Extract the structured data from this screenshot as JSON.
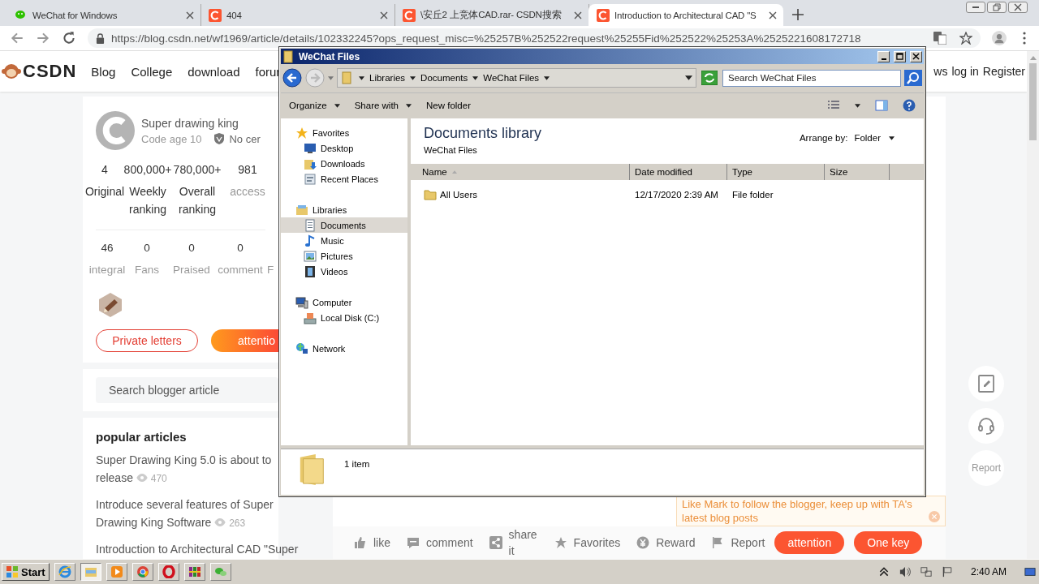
{
  "browser": {
    "tabs": [
      {
        "title": "WeChat for Windows",
        "kind": "wechat",
        "selected": false
      },
      {
        "title": "404",
        "kind": "csdn",
        "selected": false
      },
      {
        "title": "\\安丘2 上竞体CAD.rar- CSDN搜索",
        "kind": "csdn",
        "selected": false
      },
      {
        "title": "Introduction to Architectural CAD \"S",
        "kind": "csdn",
        "selected": true
      }
    ],
    "url": "https://blog.csdn.net/wf1969/article/details/102332245?ops_request_misc=%25257B%252522request%25255Fid%252522%25253A%2525221608172718"
  },
  "site_nav": {
    "logo": "CSDN",
    "items": [
      "Blog",
      "College",
      "download",
      "forur"
    ],
    "right_items": [
      "ws",
      "log in",
      "Register"
    ]
  },
  "profile": {
    "name": "Super drawing king",
    "code_age": "Code age 10",
    "certification": "No cer",
    "stats": [
      {
        "value": "4",
        "label": "Original",
        "muted": false
      },
      {
        "value": "800,000+",
        "label": "Weekly ranking",
        "muted": false
      },
      {
        "value": "780,000+",
        "label": "Overall ranking",
        "muted": false
      },
      {
        "value": "981",
        "label": "access",
        "muted": true
      }
    ],
    "stats2": [
      {
        "value": "46",
        "label": "integral"
      },
      {
        "value": "0",
        "label": "Fans"
      },
      {
        "value": "0",
        "label": "Praised"
      },
      {
        "value": "0",
        "label": "comment"
      },
      {
        "label": "F"
      }
    ],
    "private_button": "Private letters",
    "follow_button": "attentio"
  },
  "blogger_search": {
    "placeholder": "Search blogger article"
  },
  "popular_articles": {
    "title": "popular articles",
    "items": [
      {
        "title": "Super Drawing King 5.0 is about to release",
        "views": "470"
      },
      {
        "title": "Introduce several features of Super Drawing King Software",
        "views": "263"
      },
      {
        "title": "Introduction to Architectural CAD \"Super"
      }
    ]
  },
  "follow_tip": {
    "text": "Like Mark to follow the blogger, keep up with TA's latest blog posts"
  },
  "article_toolbar": {
    "actions": [
      {
        "kind": "like",
        "label": "like"
      },
      {
        "kind": "comment",
        "label": "comment"
      },
      {
        "kind": "share",
        "label": "share it"
      },
      {
        "kind": "favorites",
        "label": "Favorites"
      },
      {
        "kind": "reward",
        "label": "Reward"
      },
      {
        "kind": "report",
        "label": "Report"
      }
    ],
    "attention": "attention",
    "one_key": "One key"
  },
  "float_tools": {
    "report": "Report"
  },
  "explorer": {
    "title": "WeChat Files",
    "breadcrumb": [
      "Libraries",
      "Documents",
      "WeChat Files"
    ],
    "search": {
      "placeholder": "Search WeChat Files"
    },
    "toolbar": [
      {
        "label": "Organize",
        "dropdown": true
      },
      {
        "label": "Share with",
        "dropdown": true
      },
      {
        "label": "New folder",
        "dropdown": false
      }
    ],
    "nav": [
      {
        "label": "Favorites",
        "kind": "star",
        "selected": false,
        "children": [
          {
            "label": "Desktop",
            "kind": "desktop",
            "selected": false
          },
          {
            "label": "Downloads",
            "kind": "downloads",
            "selected": false
          },
          {
            "label": "Recent Places",
            "kind": "recent",
            "selected": false
          }
        ]
      },
      {
        "label": "Libraries",
        "kind": "library",
        "selected": false,
        "children": [
          {
            "label": "Documents",
            "kind": "document",
            "selected": true
          },
          {
            "label": "Music",
            "kind": "music",
            "selected": false
          },
          {
            "label": "Pictures",
            "kind": "pictures",
            "selected": false
          },
          {
            "label": "Videos",
            "kind": "videos",
            "selected": false
          }
        ]
      },
      {
        "label": "Computer",
        "kind": "computer",
        "selected": false,
        "children": [
          {
            "label": "Local Disk (C:)",
            "kind": "disk",
            "selected": false
          }
        ]
      },
      {
        "label": "Network",
        "kind": "network",
        "selected": false
      }
    ],
    "library_title": "Documents library",
    "library_subtitle": "WeChat Files",
    "arrange_label": "Arrange by:",
    "arrange_value": "Folder",
    "columns": [
      "Name",
      "Date modified",
      "Type",
      "Size"
    ],
    "rows": [
      {
        "name": "All Users",
        "date": "12/17/2020 2:39 AM",
        "type": "File folder"
      }
    ],
    "status": "1 item"
  },
  "taskbar": {
    "start": "Start",
    "apps": [
      {
        "kind": "ie",
        "selected": false
      },
      {
        "kind": "explorer",
        "selected": true
      },
      {
        "kind": "media",
        "selected": false
      },
      {
        "kind": "chrome",
        "selected": false
      },
      {
        "kind": "opera",
        "selected": false
      },
      {
        "kind": "winrar",
        "selected": false
      },
      {
        "kind": "wechat",
        "selected": false
      }
    ],
    "clock": "2:40 AM"
  }
}
